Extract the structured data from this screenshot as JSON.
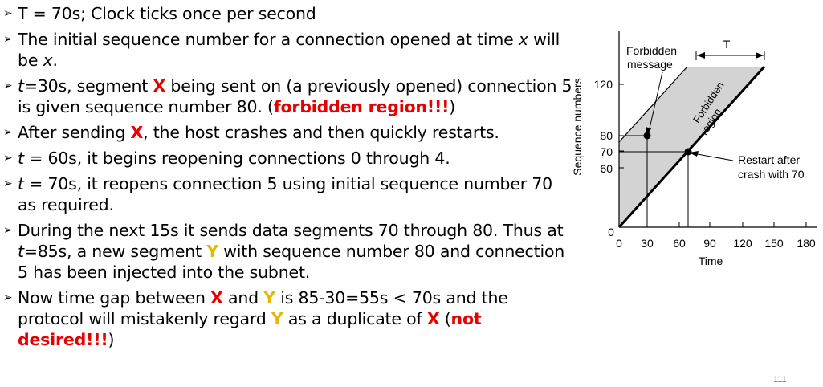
{
  "bullets": [
    {
      "id": "b1",
      "parts": [
        {
          "t": "T = 70s; Clock ticks once per second"
        }
      ]
    },
    {
      "id": "b2",
      "parts": [
        {
          "t": "The initial sequence number for a connection opened at time "
        },
        {
          "t": "x",
          "s": "it"
        },
        {
          "t": " will be "
        },
        {
          "t": "x",
          "s": "it"
        },
        {
          "t": "."
        }
      ]
    },
    {
      "id": "b3",
      "parts": [
        {
          "t": "t",
          "s": "it"
        },
        {
          "t": "=30s, segment "
        },
        {
          "t": "X",
          "s": "red"
        },
        {
          "t": " being sent on (a previously opened) connection 5 is given sequence number 80.  ("
        },
        {
          "t": "forbidden region!!!",
          "s": "red"
        },
        {
          "t": ")"
        }
      ]
    },
    {
      "id": "b4",
      "parts": [
        {
          "t": "After sending "
        },
        {
          "t": "X",
          "s": "red"
        },
        {
          "t": ", the host crashes and then quickly restarts."
        }
      ]
    },
    {
      "id": "b5",
      "parts": [
        {
          "t": "t",
          "s": "it"
        },
        {
          "t": " = 60s, it begins reopening connections 0 through 4."
        }
      ]
    },
    {
      "id": "b6",
      "parts": [
        {
          "t": "t",
          "s": "it"
        },
        {
          "t": " = 70s, it reopens connection 5 using initial sequence number 70 as required."
        }
      ]
    },
    {
      "id": "b7",
      "parts": [
        {
          "t": "During the next 15s it sends data segments 70 through 80. Thus at "
        },
        {
          "t": "t",
          "s": "it"
        },
        {
          "t": "=85s, a new segment "
        },
        {
          "t": "Y",
          "s": "yel"
        },
        {
          "t": " with sequence number 80 and connection 5 has been injected into the subnet."
        }
      ]
    },
    {
      "id": "b8",
      "parts": [
        {
          "t": "Now time gap between "
        },
        {
          "t": "X",
          "s": "red"
        },
        {
          "t": " and "
        },
        {
          "t": "Y",
          "s": "yel"
        },
        {
          "t": " is 85-30=55s < 70s and the protocol will mistakenly regard "
        },
        {
          "t": "Y",
          "s": "yel"
        },
        {
          "t": " as a duplicate of "
        },
        {
          "t": "X",
          "s": "red"
        },
        {
          "t": " ("
        },
        {
          "t": "not desired!!!",
          "s": "red"
        },
        {
          "t": ")"
        }
      ]
    }
  ],
  "diagram": {
    "y_axis_label": "Sequence numbers",
    "x_axis_label": "Time",
    "y_ticks": [
      "0",
      "60",
      "70",
      "80",
      "120"
    ],
    "x_ticks": [
      "0",
      "30",
      "60",
      "90",
      "120",
      "150",
      "180"
    ],
    "forbidden_message_line1": "Forbidden",
    "forbidden_message_line2": "message",
    "t_label": "T",
    "region_line1": "Forbidden",
    "region_line2": "region",
    "restart_line1": "Restart after",
    "restart_line2": "crash with 70",
    "region_color": "#d3d3d3"
  },
  "page_number": "111"
}
